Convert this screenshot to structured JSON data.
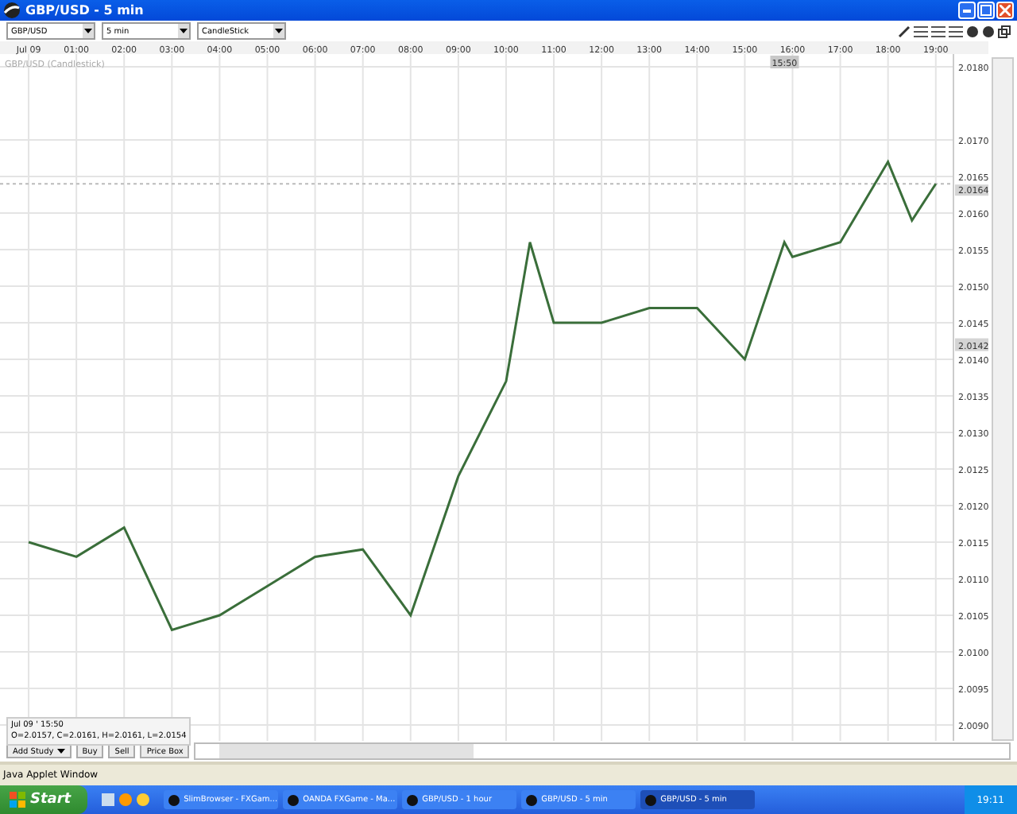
{
  "window": {
    "title": "GBP/USD - 5 min"
  },
  "toolbar": {
    "dropdowns": [
      {
        "value": "GBP/USD"
      },
      {
        "value": "5 min"
      },
      {
        "value": "CandleStick"
      }
    ]
  },
  "chart": {
    "legend_suffix": "(Candlestick)",
    "cursor_time": "15:50",
    "marker_price": "2.0142",
    "info": {
      "time": "Jul 09 ' 15:50",
      "ohlc": "O=2.0157, C=2.0161, H=2.0161, L=2.0154"
    },
    "chart_data": {
      "type": "line",
      "x": [
        0,
        1,
        2,
        3,
        4,
        5,
        6,
        7,
        8,
        9,
        10,
        10.5,
        11,
        12,
        13,
        14,
        15,
        15.83,
        16,
        17,
        18,
        18.5,
        19
      ],
      "series": [
        {
          "name": "GBP/USD",
          "color": "#3a6e3a",
          "values": [
            2.0115,
            2.0113,
            2.0117,
            2.0103,
            2.0105,
            2.0109,
            2.0113,
            2.0114,
            2.0105,
            2.0124,
            2.0137,
            2.0156,
            2.0145,
            2.0145,
            2.0147,
            2.0147,
            2.014,
            2.0156,
            2.0154,
            2.0156,
            2.0167,
            2.0159,
            2.0164
          ]
        }
      ],
      "xlim": [
        -0.6,
        19.37
      ],
      "ylim": [
        2.009,
        2.018
      ],
      "grid": true,
      "ref_lines": [
        {
          "axis": "y",
          "value": 2.0164,
          "label": "2.0164"
        }
      ],
      "xticks": [
        {
          "value": 0,
          "label": "Jul 09"
        },
        {
          "value": 1,
          "label": "01:00"
        },
        {
          "value": 2,
          "label": "02:00"
        },
        {
          "value": 3,
          "label": "03:00"
        },
        {
          "value": 4,
          "label": "04:00"
        },
        {
          "value": 5,
          "label": "05:00"
        },
        {
          "value": 6,
          "label": "06:00"
        },
        {
          "value": 7,
          "label": "07:00"
        },
        {
          "value": 8,
          "label": "08:00"
        },
        {
          "value": 9,
          "label": "09:00"
        },
        {
          "value": 10,
          "label": "10:00"
        },
        {
          "value": 11,
          "label": "11:00"
        },
        {
          "value": 12,
          "label": "12:00"
        },
        {
          "value": 13,
          "label": "13:00"
        },
        {
          "value": 14,
          "label": "14:00"
        },
        {
          "value": 15,
          "label": "15:00"
        },
        {
          "value": 16,
          "label": "16:00"
        },
        {
          "value": 17,
          "label": "17:00"
        },
        {
          "value": 18,
          "label": "18:00"
        },
        {
          "value": 19,
          "label": "19:00"
        }
      ],
      "yticks": [
        {
          "value": 2.009,
          "label": "2.0090"
        },
        {
          "value": 2.0095,
          "label": "2.0095"
        },
        {
          "value": 2.01,
          "label": "2.0100"
        },
        {
          "value": 2.0105,
          "label": "2.0105"
        },
        {
          "value": 2.011,
          "label": "2.0110"
        },
        {
          "value": 2.0115,
          "label": "2.0115"
        },
        {
          "value": 2.012,
          "label": "2.0120"
        },
        {
          "value": 2.0125,
          "label": "2.0125"
        },
        {
          "value": 2.013,
          "label": "2.0130"
        },
        {
          "value": 2.0135,
          "label": "2.0135"
        },
        {
          "value": 2.014,
          "label": "2.0140"
        },
        {
          "value": 2.0145,
          "label": "2.0145"
        },
        {
          "value": 2.015,
          "label": "2.0150"
        },
        {
          "value": 2.0155,
          "label": "2.0155"
        },
        {
          "value": 2.016,
          "label": "2.0160"
        },
        {
          "value": 2.0165,
          "label": "2.0165"
        },
        {
          "value": 2.017,
          "label": "2.0170"
        },
        {
          "value": 2.018,
          "label": "2.0180"
        }
      ]
    }
  },
  "bottom_buttons": [
    {
      "label": "Add Study",
      "kind": "dropdown"
    },
    {
      "label": "Buy",
      "kind": "button"
    },
    {
      "label": "Sell",
      "kind": "button"
    },
    {
      "label": "Price Box",
      "kind": "button"
    }
  ],
  "status_bar": "Java Applet Window",
  "taskbar": {
    "start": "Start",
    "tasks": [
      {
        "label": "SlimBrowser - FXGam...",
        "selected": false
      },
      {
        "label": "OANDA FXGame - Ma...",
        "selected": false
      },
      {
        "label": "GBP/USD - 1 hour",
        "selected": false
      },
      {
        "label": "GBP/USD - 5 min",
        "selected": false
      },
      {
        "label": "GBP/USD - 5 min",
        "selected": true
      }
    ],
    "clock": "19:11"
  }
}
